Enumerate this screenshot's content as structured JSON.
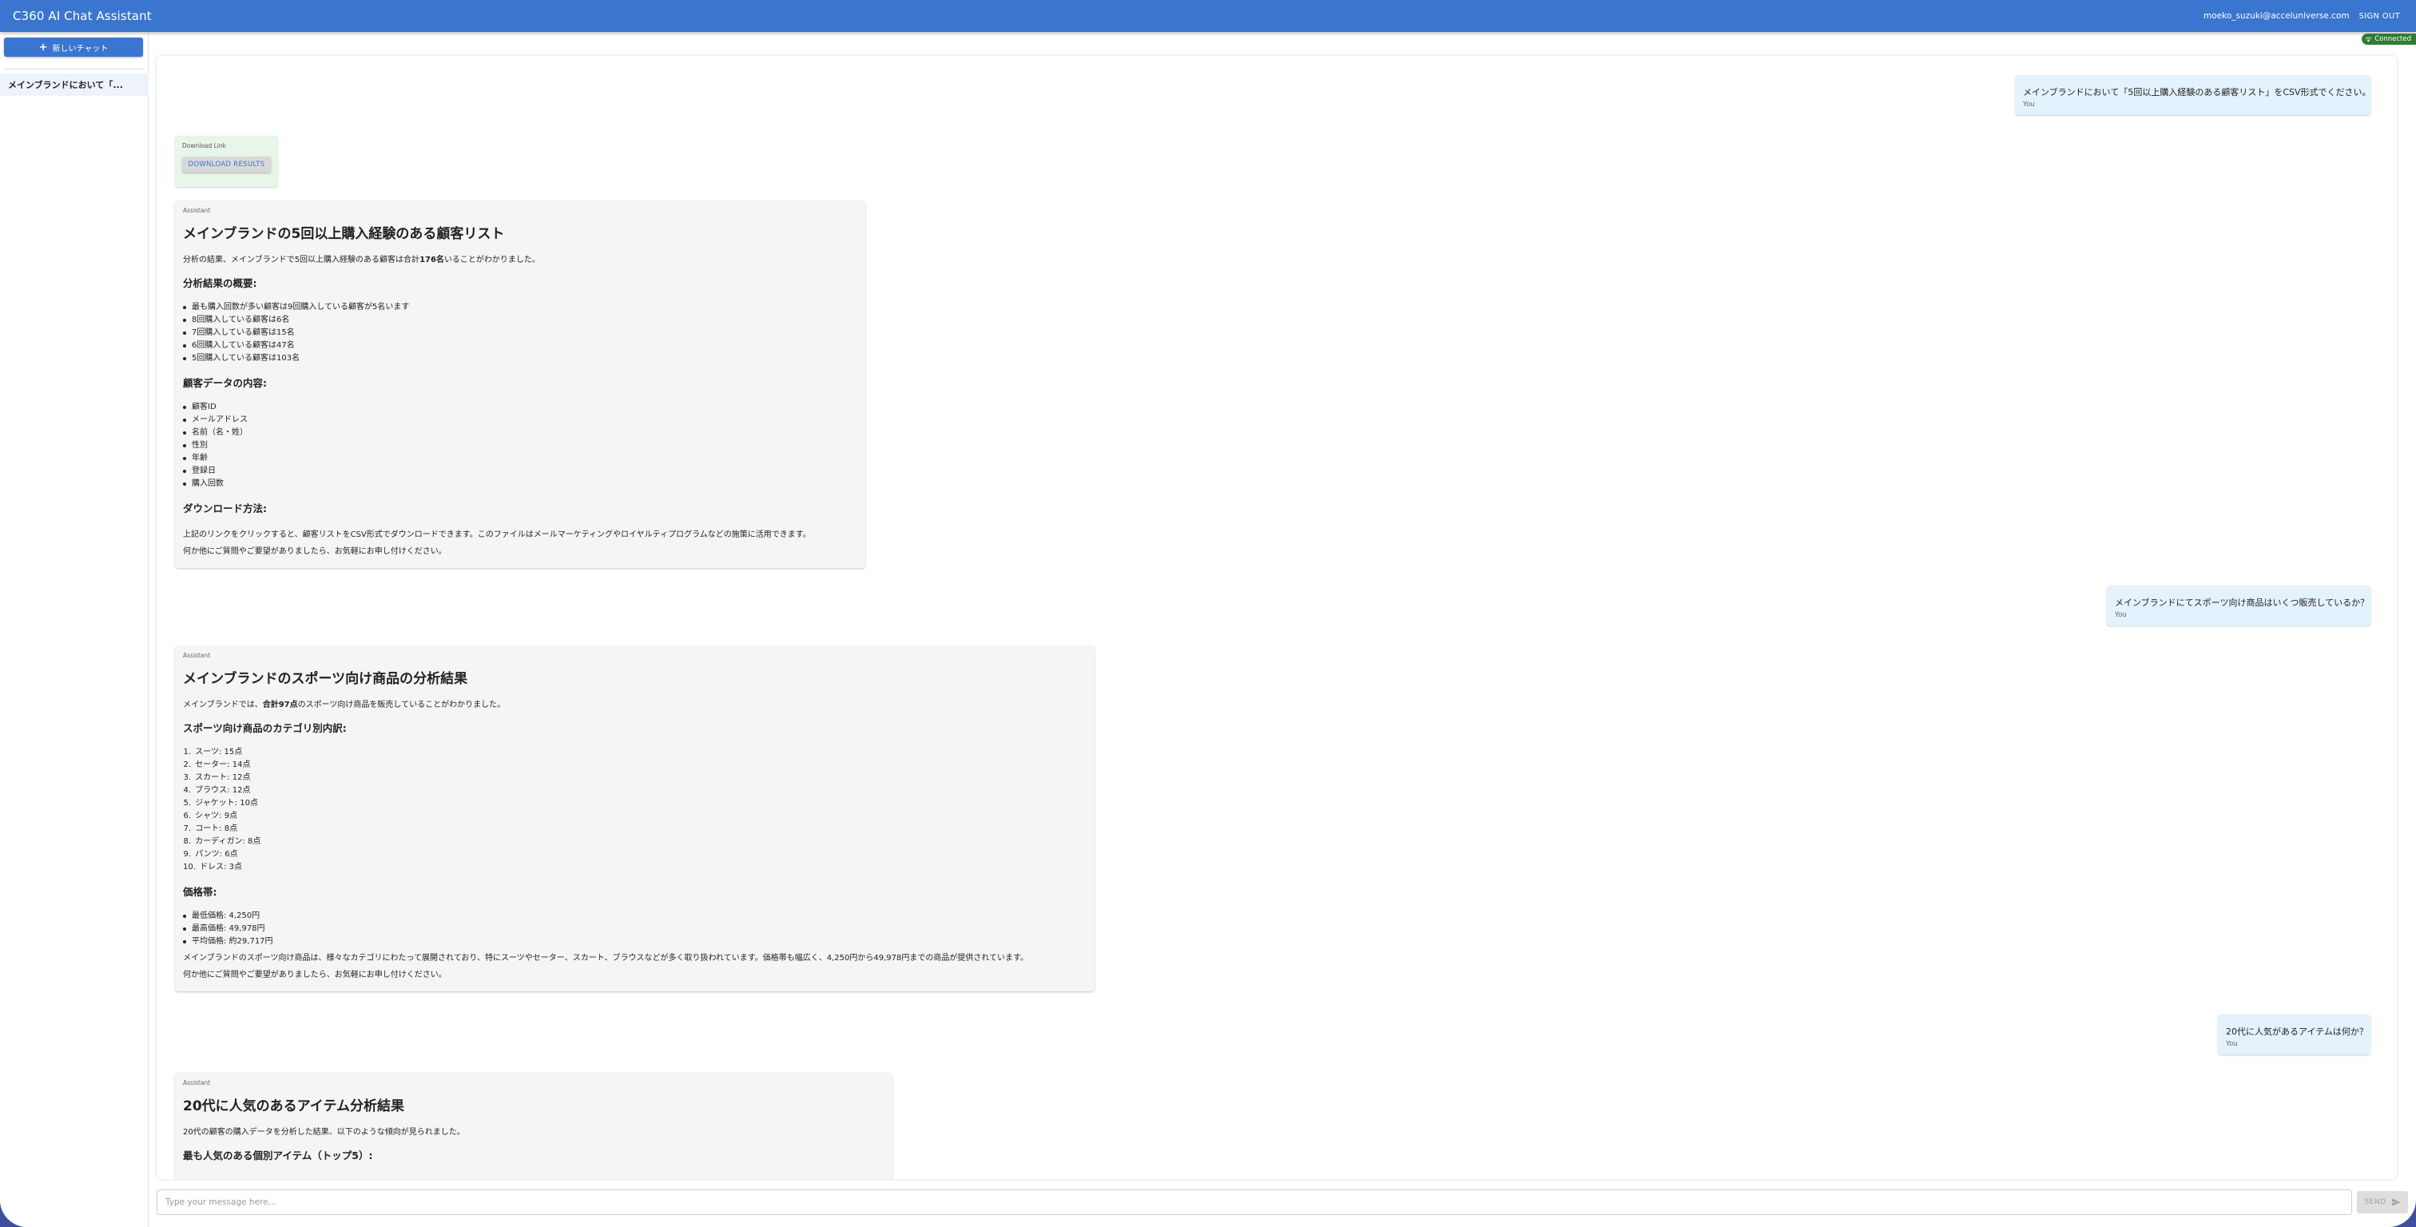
{
  "header": {
    "title": "C360 AI Chat Assistant",
    "email": "moeko_suzuki@acceluniverse.com",
    "sign_out": "SIGN OUT",
    "connection_status": "Connected"
  },
  "sidebar": {
    "new_chat_label": "新しいチャット",
    "items": [
      {
        "label": "メインブランドにおいて「..."
      }
    ]
  },
  "messages": {
    "user1": {
      "text": "メインブランドにおいて「5回以上購入経験のある顧客リスト」をCSV形式でください。",
      "author": "You"
    },
    "download": {
      "label": "Download Link",
      "button": "DOWNLOAD RESULTS"
    },
    "asst1": {
      "author": "Assistant",
      "title": "メインブランドの5回以上購入経験のある顧客リスト",
      "intro_prefix": "分析の結果、メインブランドで5回以上購入経験のある顧客は合計",
      "intro_bold": "176名",
      "intro_suffix": "いることがわかりました。",
      "summary_heading": "分析結果の概要:",
      "summary_items": [
        "最も購入回数が多い顧客は9回購入している顧客が5名います",
        "8回購入している顧客は6名",
        "7回購入している顧客は15名",
        "6回購入している顧客は47名",
        "5回購入している顧客は103名"
      ],
      "data_heading": "顧客データの内容:",
      "data_items": [
        "顧客ID",
        "メールアドレス",
        "名前（名・姓）",
        "性別",
        "年齢",
        "登録日",
        "購入回数"
      ],
      "download_heading": "ダウンロード方法:",
      "download_text": "上記のリンクをクリックすると、顧客リストをCSV形式でダウンロードできます。このファイルはメールマーケティングやロイヤルティプログラムなどの施策に活用できます。",
      "closing": "何か他にご質問やご要望がありましたら、お気軽にお申し付けください。"
    },
    "user2": {
      "text": "メインブランドにてスポーツ向け商品はいくつ販売しているか？",
      "author": "You"
    },
    "asst2": {
      "author": "Assistant",
      "title": "メインブランドのスポーツ向け商品の分析結果",
      "intro_prefix": "メインブランドでは、",
      "intro_bold": "合計97点",
      "intro_suffix": "のスポーツ向け商品を販売していることがわかりました。",
      "category_heading": "スポーツ向け商品のカテゴリ別内訳:",
      "category_items": [
        "スーツ: 15点",
        "セーター: 14点",
        "スカート: 12点",
        "ブラウス: 12点",
        "ジャケット: 10点",
        "シャツ: 9点",
        "コート: 8点",
        "カーディガン: 8点",
        "パンツ: 6点",
        "ドレス: 3点"
      ],
      "price_heading": "価格帯:",
      "price_items": [
        "最低価格: 4,250円",
        "最高価格: 49,978円",
        "平均価格: 約29,717円"
      ],
      "summary": "メインブランドのスポーツ向け商品は、様々なカテゴリにわたって展開されており、特にスーツやセーター、スカート、ブラウスなどが多く取り扱われています。価格帯も幅広く、4,250円から49,978円までの商品が提供されています。",
      "closing": "何か他にご質問やご要望がありましたら、お気軽にお申し付けください。"
    },
    "user3": {
      "text": "20代に人気があるアイテムは何か？",
      "author": "You"
    },
    "asst3": {
      "author": "Assistant",
      "title": "20代に人気のあるアイテム分析結果",
      "intro": "20代の顧客の購入データを分析した結果、以下のような傾向が見られました。",
      "top_heading": "最も人気のある個別アイテム（トップ5）:"
    }
  },
  "input": {
    "placeholder": "Type your message here...",
    "send_label": "SEND"
  },
  "colors": {
    "primary": "#3a76cf",
    "user_bubble": "#e3f2fd",
    "assistant_bubble": "#f5f5f5",
    "download_bubble": "#e8f5e9",
    "connected": "#2e7d32"
  }
}
